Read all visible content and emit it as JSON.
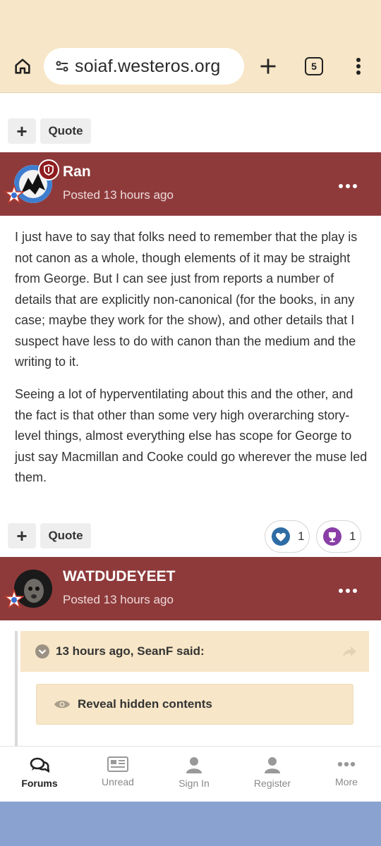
{
  "browser": {
    "url": "soiaf.westeros.org",
    "tab_count": "5"
  },
  "post_actions": {
    "plus_label": "+",
    "quote_label": "Quote"
  },
  "posts": [
    {
      "author": "Ran",
      "posted": "Posted 13 hours ago",
      "paragraphs": [
        "I just have to say that folks need to remember that the play is not canon as a whole, though elements of it may be straight from George. But I can see just from reports a number of details that are explicitly non-canonical (for the books, in any case; maybe they work for the show), and other details that I suspect have less to do with canon than the medium and the writing to it.",
        "Seeing a lot of hyperventilating about this and the other, and the fact is that other than some very high overarching story-level things, almost everything else has scope for George to just say Macmillan and Cooke could go wherever the muse led them."
      ],
      "reactions": [
        {
          "icon": "heart-icon",
          "count": "1",
          "color": "#2e6ca4"
        },
        {
          "icon": "trophy-icon",
          "count": "1",
          "color": "#8a3fa8"
        }
      ]
    },
    {
      "author": "WATDUDEYEET",
      "posted": "Posted 13 hours ago",
      "quote": {
        "header": "13 hours ago, SeanF said:",
        "reveal_label": "Reveal hidden contents"
      }
    }
  ],
  "bottom_nav": [
    {
      "label": "Forums",
      "icon": "forums-icon",
      "active": true
    },
    {
      "label": "Unread",
      "icon": "unread-icon",
      "active": false
    },
    {
      "label": "Sign In",
      "icon": "sign-in-icon",
      "active": false
    },
    {
      "label": "Register",
      "icon": "register-icon",
      "active": false
    },
    {
      "label": "More",
      "icon": "more-icon",
      "active": false
    }
  ],
  "colors": {
    "browser_bar": "#f7e6c7",
    "post_header": "#8e3a3b",
    "quote_bg": "#f7e6c7",
    "system_bar": "#8aa2cf"
  }
}
